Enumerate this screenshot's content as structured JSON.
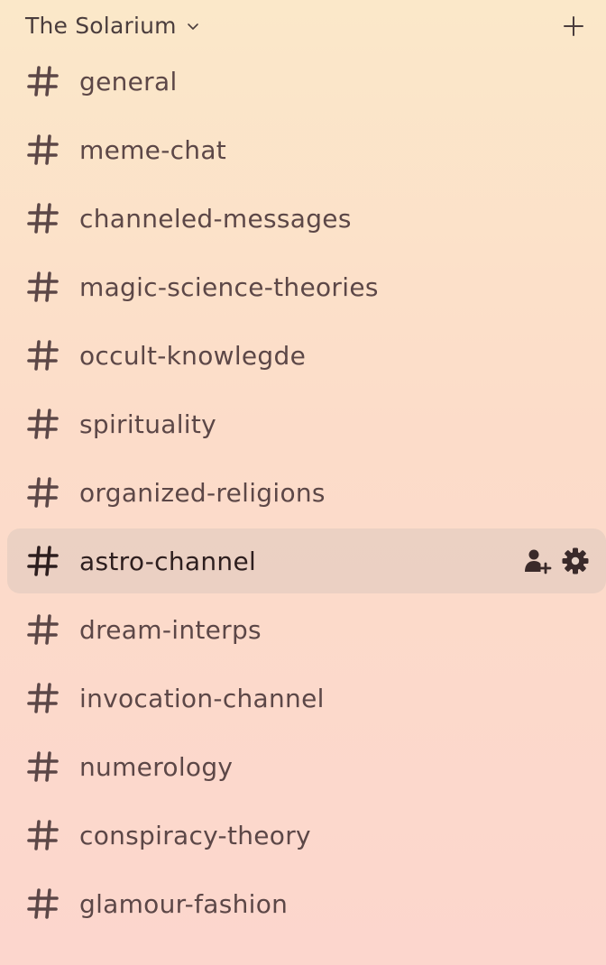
{
  "server": {
    "name": "The Solarium",
    "menu_icon": "chevron-down-icon",
    "add_icon": "plus-icon"
  },
  "channels": [
    {
      "name": "general",
      "selected": false
    },
    {
      "name": "meme-chat",
      "selected": false
    },
    {
      "name": "channeled-messages",
      "selected": false
    },
    {
      "name": "magic-science-theories",
      "selected": false
    },
    {
      "name": "occult-knowlegde",
      "selected": false
    },
    {
      "name": "spirituality",
      "selected": false
    },
    {
      "name": "organized-religions",
      "selected": false
    },
    {
      "name": "astro-channel",
      "selected": true,
      "actions": [
        "invite-member-icon",
        "gear-icon"
      ]
    },
    {
      "name": "dream-interps",
      "selected": false
    },
    {
      "name": "invocation-channel",
      "selected": false
    },
    {
      "name": "numerology",
      "selected": false
    },
    {
      "name": "conspiracy-theory",
      "selected": false
    },
    {
      "name": "glamour-fashion",
      "selected": false
    }
  ],
  "colors": {
    "background_top": "#fbe8c9",
    "background_bottom": "#fcd6cd",
    "text": "#5c4747",
    "selected_text": "#2d1e1e",
    "selected_bg": "#e8d4c8"
  }
}
